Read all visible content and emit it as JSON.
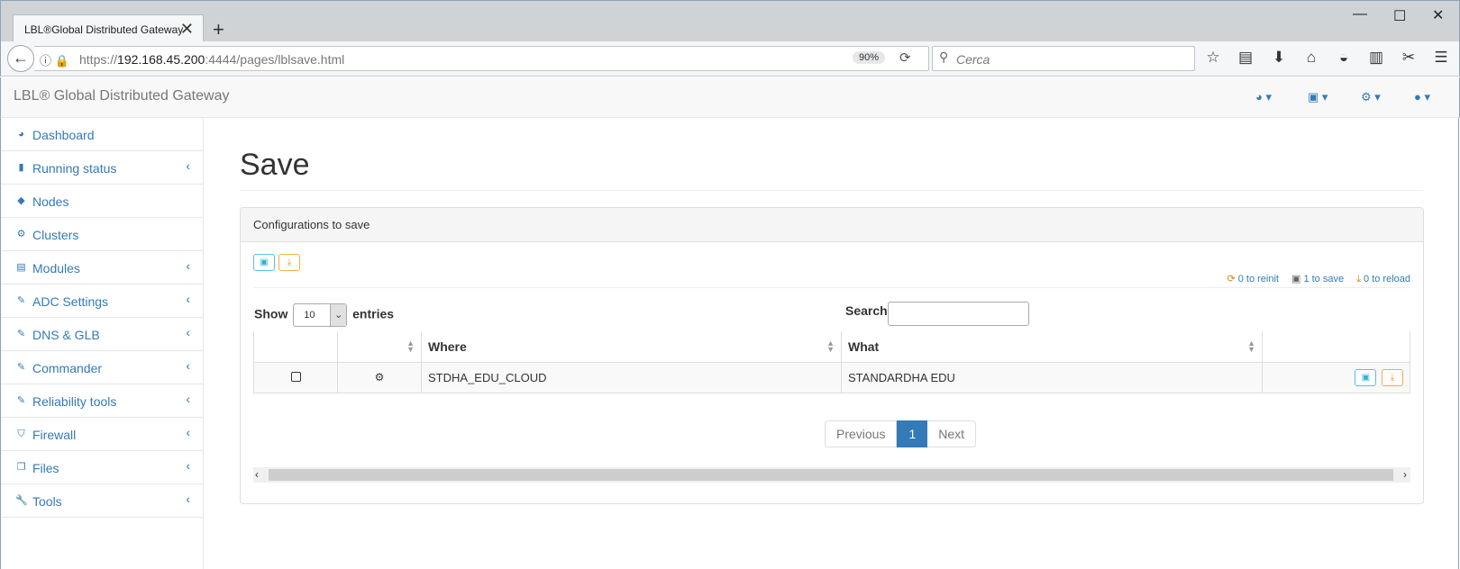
{
  "browser": {
    "tab_title": "LBL®Global Distributed Gateway",
    "url_prefix": "https://",
    "url_host": "192.168.45.200",
    "url_path": ":4444/pages/lblsave.html",
    "zoom": "90%",
    "search_placeholder": "Cerca"
  },
  "app": {
    "brand": "LBL® Global Distributed Gateway"
  },
  "sidebar": {
    "items": [
      {
        "label": "Dashboard",
        "icon": "dashboard-icon",
        "has_arrow": false
      },
      {
        "label": "Running status",
        "icon": "bar-chart-icon",
        "has_arrow": true
      },
      {
        "label": "Nodes",
        "icon": "cube-icon",
        "has_arrow": false
      },
      {
        "label": "Clusters",
        "icon": "cogs-icon",
        "has_arrow": false
      },
      {
        "label": "Modules",
        "icon": "table-icon",
        "has_arrow": true
      },
      {
        "label": "ADC Settings",
        "icon": "edit-icon",
        "has_arrow": true
      },
      {
        "label": "DNS & GLB",
        "icon": "edit-icon",
        "has_arrow": true
      },
      {
        "label": "Commander",
        "icon": "edit-icon",
        "has_arrow": true
      },
      {
        "label": "Reliability tools",
        "icon": "edit-icon",
        "has_arrow": true
      },
      {
        "label": "Firewall",
        "icon": "shield-icon",
        "has_arrow": true
      },
      {
        "label": "Files",
        "icon": "files-icon",
        "has_arrow": true
      },
      {
        "label": "Tools",
        "icon": "wrench-icon",
        "has_arrow": true
      }
    ]
  },
  "main": {
    "title": "Save",
    "panel_title": "Configurations to save",
    "status": {
      "reinit": "0 to reinit",
      "save": "1 to save",
      "reload": "0 to reload"
    },
    "show_label": "Show",
    "entries_value": "10",
    "entries_label": "entries",
    "search_label": "Search:",
    "table": {
      "columns": [
        "",
        "",
        "Where",
        "What",
        ""
      ],
      "rows": [
        {
          "where": "STDHA_EDU_CLOUD",
          "what": "STANDARDHA EDU"
        }
      ]
    },
    "pagination": {
      "previous": "Previous",
      "page": "1",
      "next": "Next"
    }
  }
}
